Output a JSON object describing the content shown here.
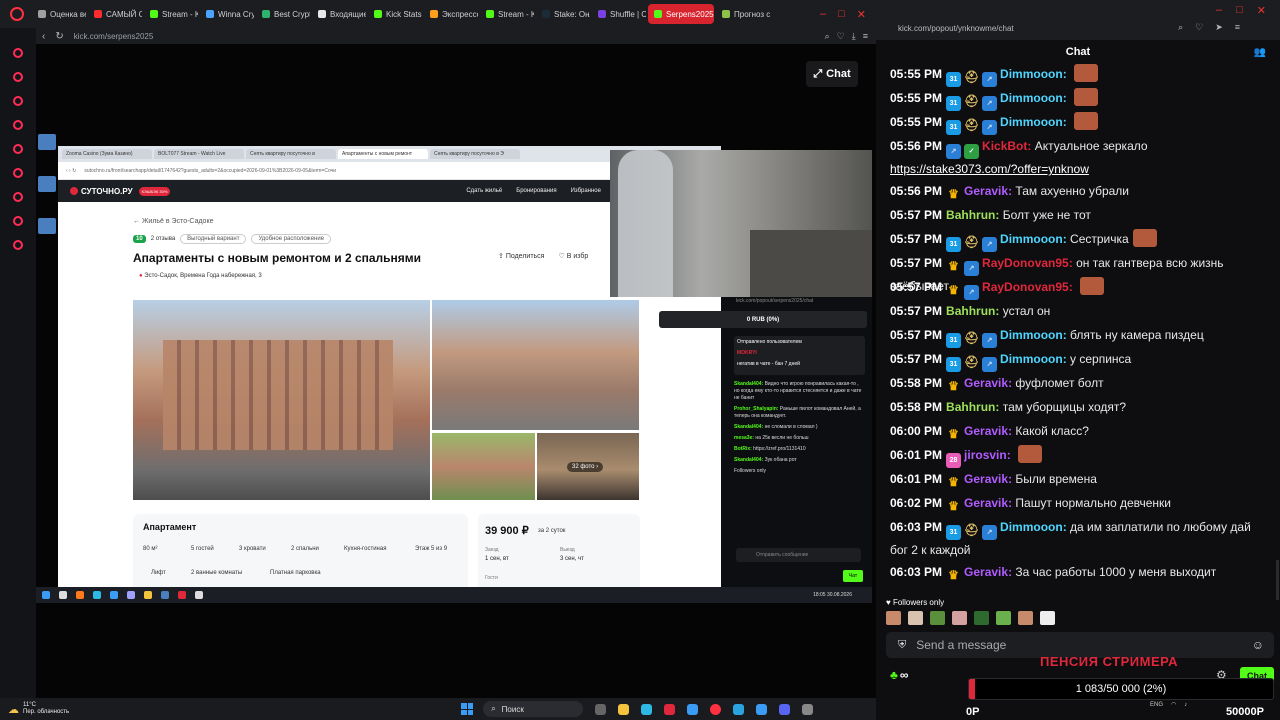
{
  "browser": {
    "tabs": [
      {
        "label": "Оценка вес",
        "color": "#a0a0a0"
      },
      {
        "label": "САМЫЙ СТ",
        "color": "#ff2d2d"
      },
      {
        "label": "Stream - Ki",
        "color": "#53fc18"
      },
      {
        "label": "Winna Cryp",
        "color": "#4aa3ff"
      },
      {
        "label": "Best Crypto",
        "color": "#2db36b"
      },
      {
        "label": "Входящие",
        "color": "#e8e8e8"
      },
      {
        "label": "Kick Stats, I",
        "color": "#53fc18"
      },
      {
        "label": "Экспрессо",
        "color": "#ff9f1c"
      },
      {
        "label": "Stream - Ki",
        "color": "#53fc18"
      },
      {
        "label": "Stake: Онлг",
        "color": "#1a2c38"
      },
      {
        "label": "Shuffle | Cr",
        "color": "#7b3fe4"
      },
      {
        "label": "Serpens2025 Strean",
        "color": "#53fc18"
      },
      {
        "label": "Прогноз с",
        "color": "#8bc34a"
      }
    ],
    "url": "kick.com/serpens2025"
  },
  "stream": {
    "chat_toggle": "Chat",
    "inner": {
      "tabs": [
        "Zooma Casino (Зума Казино)",
        "BOLT077 Stream - Watch Live",
        "Снять квартиру посуточно в",
        "Апартаменты с новым ремонт",
        "Снять квартиру посуточно в Э"
      ],
      "url": "sutochno.ru/front/searchapp/detail/1747642?guests_adults=2&occupied=2026-09-01%3B2026-09-05&term=Сочи",
      "logo": "СУТОЧНО.РУ",
      "cashback": "КЭШБЭК 30%",
      "nav": [
        "Сдать жильё",
        "Бронирования",
        "Избранное"
      ],
      "breadcrumb": "← Жильё в Эсто-Садоке",
      "rating": "10",
      "reviews": "2 отзыва",
      "chips": [
        "Выгодный вариант",
        "Удобное расположение"
      ],
      "title": "Апартаменты с новым ремонтом и 2 спальнями",
      "address": "Эсто-Садок, Времена Года набережная, 3",
      "share": "Поделиться",
      "fav": "В избр",
      "photo_count": "32 фото ›",
      "apt_heading": "Апартамент",
      "features": [
        "80 м²",
        "5 гостей",
        "3 кровати",
        "2 спальни",
        "Кухня-гостиная",
        "Этаж 5 из 9",
        "Лифт",
        "2 ванные комнаты",
        "Платная парковка"
      ],
      "price": "39 900 ₽",
      "price_per": "за 2 суток",
      "checkin_label": "Заезд",
      "checkin": "1 сен, вт",
      "checkout_label": "Выезд",
      "checkout": "3 сен, чт",
      "guests_label": "Гости"
    },
    "mini": {
      "url": "kick.com/popout/serpens2025/chat",
      "goal": "0 RUB (0%)",
      "pinned_by": "Отправлено пользователем",
      "pinned_user": "MOKRYI",
      "pinned_text": "негатив в чате - бан 7 дней",
      "messages": [
        {
          "user": "Skandal404:",
          "text": "Видно что игрою понравилась какая-то , но когда ему кто-то нравится стесняется и даже в чате не банит"
        },
        {
          "user": "Prohor_Shalyapin:",
          "text": "Раньше пилот командовал Аней, а теперь она командует."
        },
        {
          "user": "Skandal404:",
          "text": "не сломали в сломал )"
        },
        {
          "user": "mesa3e:",
          "text": "на 25к весли не больш"
        },
        {
          "user": "BotRix:",
          "text": "https://zref.pro/1131410"
        },
        {
          "user": "Skandal404:",
          "text": "Зук обана рот"
        }
      ],
      "followers": "Followers only",
      "input_placeholder": "Отправить сообщение",
      "send": "Чат"
    },
    "taskbar_clock": "18:05\n30.08.2026"
  },
  "taskbar": {
    "temp": "11°C",
    "weather": "Пер. облачность",
    "search": "Поиск"
  },
  "popout": {
    "url": "kick.com/popout/ynknowme/chat",
    "header": "Chat",
    "messages": [
      {
        "time": "05:55 PM",
        "user": "Dimmooon:",
        "color": "#4fd6ff",
        "badges": [
          "sub",
          "helmet",
          "og"
        ],
        "text": "",
        "emote": true
      },
      {
        "time": "05:55 PM",
        "user": "Dimmooon:",
        "color": "#4fd6ff",
        "badges": [
          "sub",
          "helmet",
          "og"
        ],
        "text": "",
        "emote": true
      },
      {
        "time": "05:55 PM",
        "user": "Dimmooon:",
        "color": "#4fd6ff",
        "badges": [
          "sub",
          "helmet",
          "og"
        ],
        "text": "",
        "emote": true
      },
      {
        "time": "05:56 PM",
        "user": "KickBot:",
        "color": "#e0283c",
        "badges": [
          "og",
          "verified"
        ],
        "text": "Актуальное зеркало",
        "link": "https://stake3073.com/?offer=ynknow"
      },
      {
        "time": "05:56 PM",
        "user": "Geravik:",
        "color": "#b15cff",
        "badges": [
          "crown"
        ],
        "text": "Там ахуенно убрали"
      },
      {
        "time": "05:57 PM",
        "user": "Bahhrun:",
        "color": "#9ee05a",
        "badges": [],
        "text": "Болт уже не тот"
      },
      {
        "time": "05:57 PM",
        "user": "Dimmooon:",
        "color": "#4fd6ff",
        "badges": [
          "sub",
          "helmet",
          "og"
        ],
        "text": "Сестричка",
        "emote": true
      },
      {
        "time": "05:57 PM",
        "user": "RayDonovan95:",
        "color": "#e0283c",
        "badges": [
          "crown",
          "og"
        ],
        "text": "он так гантвера всю жизнь заёбывает"
      },
      {
        "time": "05:57 PM",
        "user": "RayDonovan95:",
        "color": "#e0283c",
        "badges": [
          "crown",
          "og"
        ],
        "text": "",
        "emote": true
      },
      {
        "time": "05:57 PM",
        "user": "Bahhrun:",
        "color": "#9ee05a",
        "badges": [],
        "text": "устал он"
      },
      {
        "time": "05:57 PM",
        "user": "Dimmooon:",
        "color": "#4fd6ff",
        "badges": [
          "sub",
          "helmet",
          "og"
        ],
        "text": "блять ну камера пиздец"
      },
      {
        "time": "05:57 PM",
        "user": "Dimmooon:",
        "color": "#4fd6ff",
        "badges": [
          "sub",
          "helmet",
          "og"
        ],
        "text": "у серпинса"
      },
      {
        "time": "05:58 PM",
        "user": "Geravik:",
        "color": "#b15cff",
        "badges": [
          "crown"
        ],
        "text": "фуфломет болт"
      },
      {
        "time": "05:58 PM",
        "user": "Bahhrun:",
        "color": "#9ee05a",
        "badges": [],
        "text": "там уборщицы ходят?"
      },
      {
        "time": "06:00 PM",
        "user": "Geravik:",
        "color": "#b15cff",
        "badges": [
          "crown"
        ],
        "text": "Какой класс?"
      },
      {
        "time": "06:01 PM",
        "user": "jirosvin:",
        "color": "#b15cff",
        "badges": [
          "lvl"
        ],
        "text": "",
        "emote": true
      },
      {
        "time": "06:01 PM",
        "user": "Geravik:",
        "color": "#b15cff",
        "badges": [
          "crown"
        ],
        "text": "Были времена"
      },
      {
        "time": "06:02 PM",
        "user": "Geravik:",
        "color": "#b15cff",
        "badges": [
          "crown"
        ],
        "text": "Пашут нормально девченки"
      },
      {
        "time": "06:03 PM",
        "user": "Dimmooon:",
        "color": "#4fd6ff",
        "badges": [
          "sub",
          "helmet",
          "og"
        ],
        "text": "да им заплатили по любому дай бог 2 к каждой"
      },
      {
        "time": "06:03 PM",
        "user": "Geravik:",
        "color": "#b15cff",
        "badges": [
          "crown"
        ],
        "text": "За час работы 1000 у меня выходит"
      }
    ],
    "followers_only": "♥ Followers only",
    "input_placeholder": "Send a message",
    "overlay_title": "ПЕНСИЯ СТРИМЕРА",
    "chat_button": "Chat",
    "goal_text": "1 083/50 000 (2%)",
    "goal_fraction": 0.02,
    "zero_label": "0Р",
    "big_number": "50000Р",
    "tray": "ENG"
  }
}
